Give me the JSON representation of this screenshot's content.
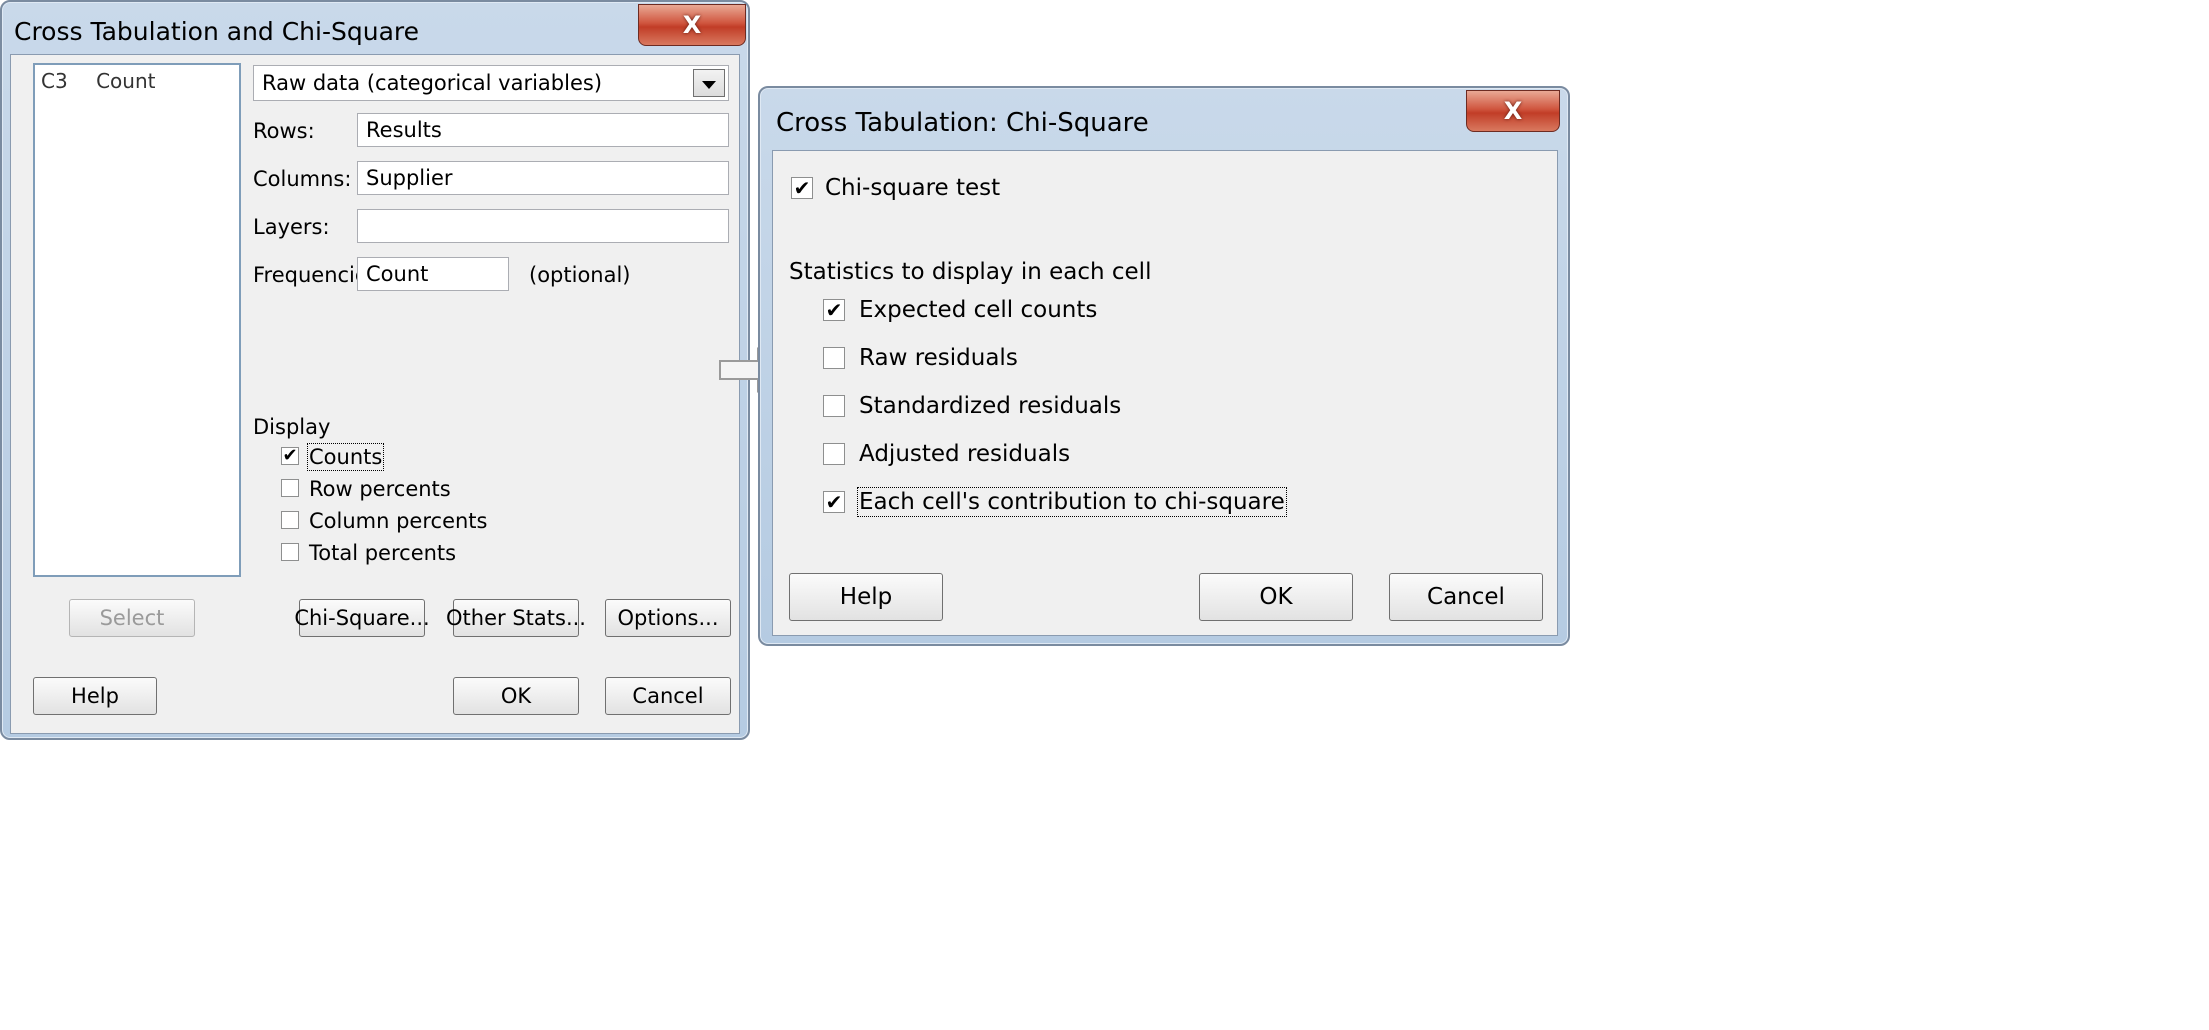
{
  "main_dialog": {
    "title": "Cross Tabulation and Chi-Square",
    "close_label": "X",
    "variables": [
      {
        "id": "C3",
        "name": "Count"
      }
    ],
    "data_type": "Raw data (categorical variables)",
    "fields": {
      "rows": {
        "label": "Rows:",
        "value": "Results"
      },
      "columns": {
        "label": "Columns:",
        "value": "Supplier"
      },
      "layers": {
        "label": "Layers:",
        "value": ""
      },
      "frequencies": {
        "label": "Frequencies:",
        "value": "Count",
        "note": "(optional)"
      }
    },
    "display": {
      "label": "Display",
      "options": [
        {
          "label": "Counts",
          "checked": true
        },
        {
          "label": "Row percents",
          "checked": false
        },
        {
          "label": "Column percents",
          "checked": false
        },
        {
          "label": "Total percents",
          "checked": false
        }
      ]
    },
    "buttons": {
      "select": "Select",
      "chi_square": "Chi-Square...",
      "other_stats": "Other Stats...",
      "options": "Options...",
      "help": "Help",
      "ok": "OK",
      "cancel": "Cancel"
    }
  },
  "chi_dialog": {
    "title": "Cross Tabulation: Chi-Square",
    "close_label": "X",
    "chi_square_test": {
      "label": "Chi-square test",
      "checked": true
    },
    "stats_heading": "Statistics to display in each cell",
    "stats": [
      {
        "label": "Expected cell counts",
        "checked": true
      },
      {
        "label": "Raw residuals",
        "checked": false
      },
      {
        "label": "Standardized residuals",
        "checked": false
      },
      {
        "label": "Adjusted residuals",
        "checked": false
      },
      {
        "label": "Each cell's contribution to chi-square",
        "checked": true
      }
    ],
    "buttons": {
      "help": "Help",
      "ok": "OK",
      "cancel": "Cancel"
    }
  },
  "check_mark": "✔"
}
